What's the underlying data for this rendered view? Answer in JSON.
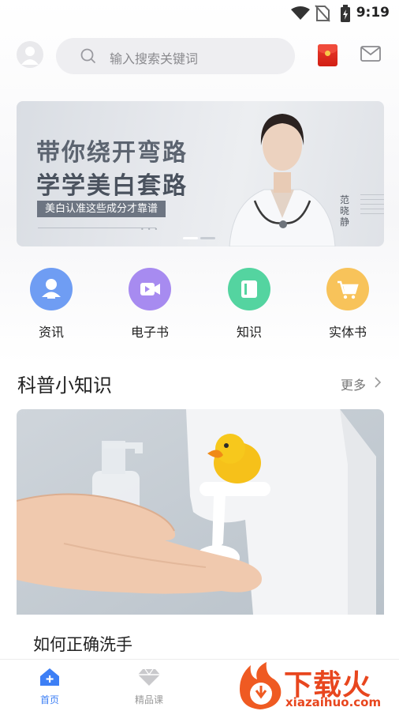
{
  "status_bar": {
    "time": "9:19",
    "icons": [
      "wifi-icon",
      "no-sim-icon",
      "battery-icon"
    ]
  },
  "header": {
    "avatar_icon": "user-avatar-icon",
    "search": {
      "placeholder": "输入搜索关键词",
      "icon": "search-icon"
    },
    "red_packet_icon": "red-envelope-icon",
    "mail_icon": "mail-icon"
  },
  "banner": {
    "headline_line1": "带你绕开弯路",
    "headline_line2": "学学美白套路",
    "tag": "美白认准这些成分才靠谱",
    "person_name": "范晓静",
    "slide_indicator": {
      "active": 1,
      "total": 2
    }
  },
  "categories": [
    {
      "label": "资讯",
      "icon": "news-person-icon",
      "color": "#6f9df3"
    },
    {
      "label": "电子书",
      "icon": "video-ebook-icon",
      "color": "#a78bf0"
    },
    {
      "label": "知识",
      "icon": "book-knowledge-icon",
      "color": "#54d4a0"
    },
    {
      "label": "实体书",
      "icon": "shopping-cart-icon",
      "color": "#f8c35a"
    }
  ],
  "section": {
    "title": "科普小知识",
    "more": "更多"
  },
  "article": {
    "title": "如何正确洗手"
  },
  "bottom_nav": [
    {
      "label": "首页",
      "icon": "home-icon",
      "active": true
    },
    {
      "label": "精品课",
      "icon": "diamond-icon",
      "active": false
    }
  ],
  "watermark": {
    "brand": "下载火",
    "url": "xiazaihuo.com"
  },
  "colors": {
    "accent": "#3d7ff5",
    "inactive": "#999999",
    "watermark": "#e8461e"
  }
}
